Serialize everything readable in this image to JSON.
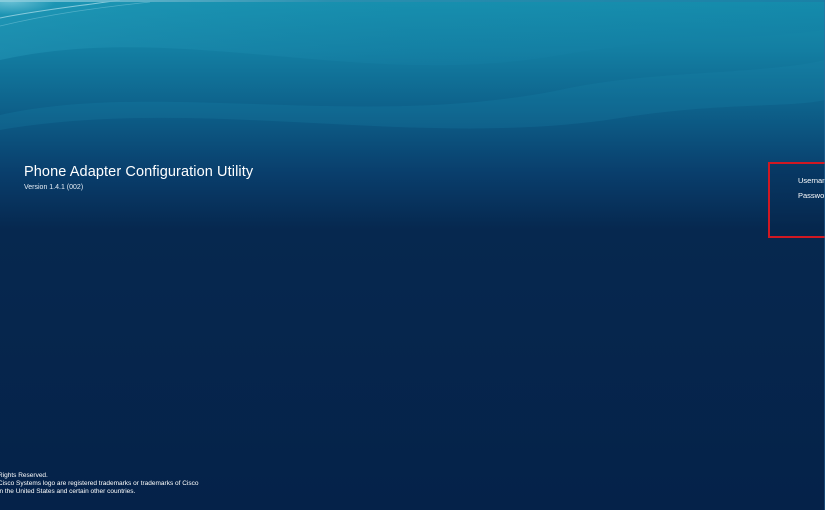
{
  "app": {
    "title": "Phone Adapter Configuration Utility",
    "version": "Version 1.4.1 (002)"
  },
  "login": {
    "username_label": "Usernam",
    "password_label": "Passwo"
  },
  "footer": {
    "line1": "Rights Reserved.",
    "line2": "Cisco Systems logo are registered trademarks or trademarks of Cisco",
    "line3": "in the United States and certain other countries."
  },
  "colors": {
    "background_top": "#1288aa",
    "background_bottom": "#052249",
    "login_border": "#d01822",
    "text": "#ffffff"
  }
}
